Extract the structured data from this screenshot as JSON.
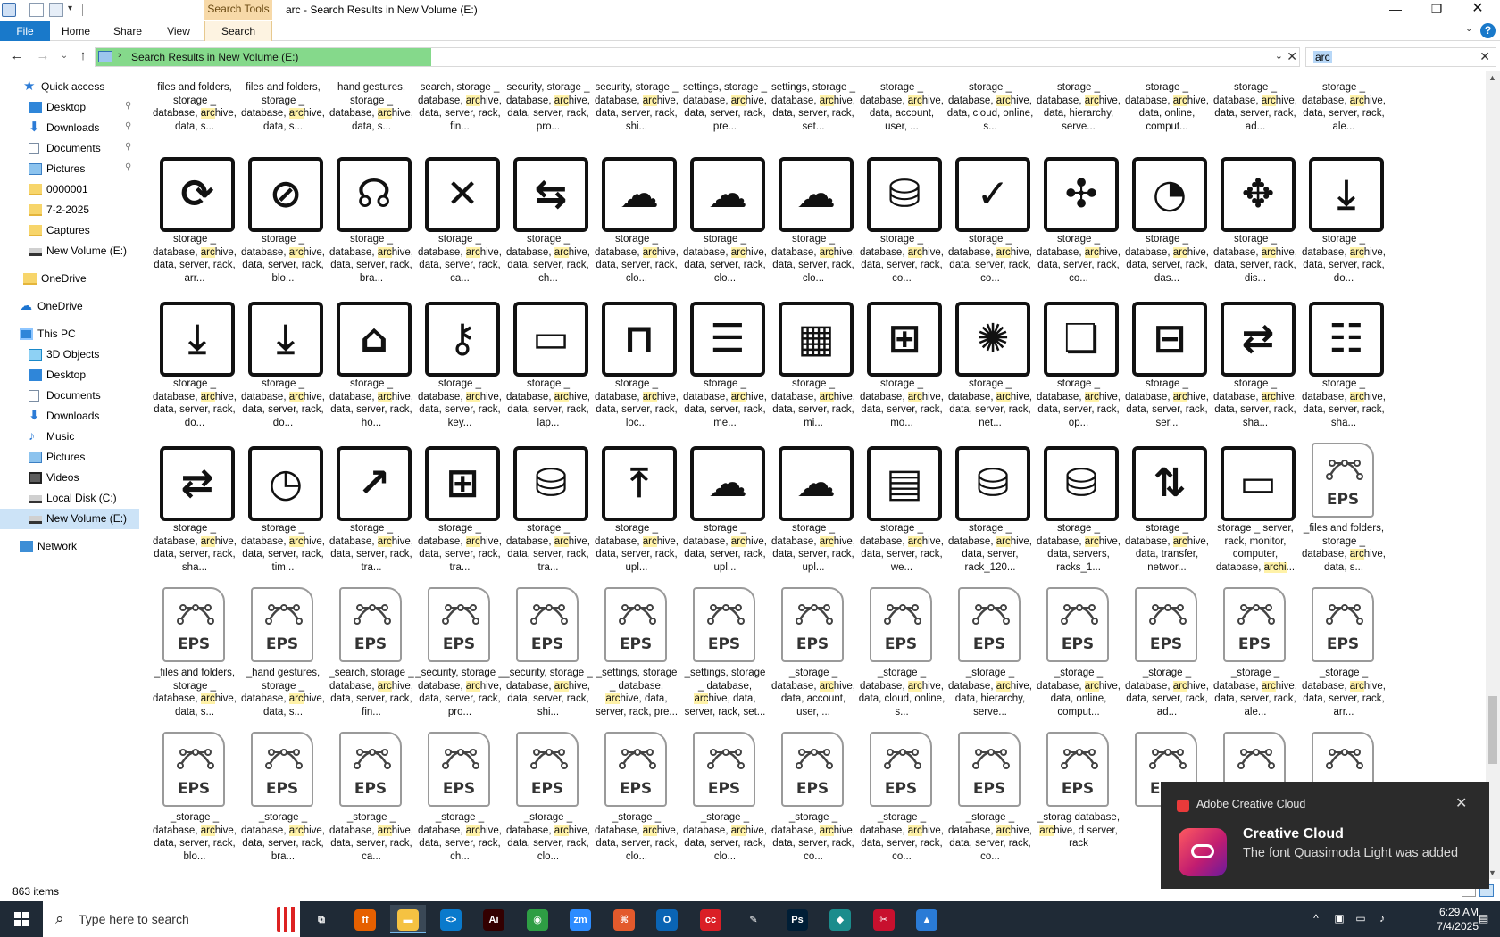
{
  "window": {
    "title": "arc - Search Results in New Volume (E:)",
    "context_tab_header": "Search Tools",
    "min_glyph": "—",
    "max_glyph": "❐",
    "close_glyph": "✕"
  },
  "ribbon": {
    "tabs": [
      "File",
      "Home",
      "Share",
      "View",
      "Search"
    ],
    "active_tab": "File"
  },
  "address": {
    "path": "Search Results in New Volume (E:)",
    "search_value": "arc"
  },
  "nav": {
    "items": [
      {
        "label": "Quick access",
        "icon": "star-icon",
        "pinned": false
      },
      {
        "label": "Desktop",
        "icon": "desktop-icon",
        "pinned": true
      },
      {
        "label": "Downloads",
        "icon": "downloads-icon",
        "pinned": true
      },
      {
        "label": "Documents",
        "icon": "documents-icon",
        "pinned": true
      },
      {
        "label": "Pictures",
        "icon": "pictures-icon",
        "pinned": true
      },
      {
        "label": "0000001",
        "icon": "folder-icon",
        "pinned": false
      },
      {
        "label": "7-2-2025",
        "icon": "folder-icon",
        "pinned": false
      },
      {
        "label": "Captures",
        "icon": "folder-icon",
        "pinned": false
      },
      {
        "label": "New Volume (E:)",
        "icon": "drive-icon",
        "pinned": false
      },
      {
        "label": "OneDrive",
        "icon": "folder-icon",
        "pinned": false
      },
      {
        "label": "OneDrive",
        "icon": "cloud-icon",
        "pinned": false
      },
      {
        "label": "This PC",
        "icon": "pc-icon",
        "pinned": false
      },
      {
        "label": "3D Objects",
        "icon": "3d-objects-icon",
        "pinned": false
      },
      {
        "label": "Desktop",
        "icon": "desktop-icon",
        "pinned": false
      },
      {
        "label": "Documents",
        "icon": "documents-icon",
        "pinned": false
      },
      {
        "label": "Downloads",
        "icon": "downloads-icon",
        "pinned": false
      },
      {
        "label": "Music",
        "icon": "music-icon",
        "pinned": false
      },
      {
        "label": "Pictures",
        "icon": "pictures-icon",
        "pinned": false
      },
      {
        "label": "Videos",
        "icon": "videos-icon",
        "pinned": false
      },
      {
        "label": "Local Disk (C:)",
        "icon": "drive-icon",
        "pinned": false
      },
      {
        "label": "New Volume (E:)",
        "icon": "drive-icon",
        "pinned": false
      },
      {
        "label": "Network",
        "icon": "network-icon",
        "pinned": false
      }
    ],
    "selected": "New Volume (E:)"
  },
  "files": {
    "rows": [
      {
        "kind": "partial",
        "items": [
          {
            "pre": "files and folders, storage _ database, ",
            "hl": "arc",
            "post": "hive, data, s..."
          },
          {
            "pre": "files and folders, storage _ database, ",
            "hl": "arc",
            "post": "hive, data, s..."
          },
          {
            "pre": "hand gestures, storage _ database, ",
            "hl": "arc",
            "post": "hive, data, s..."
          },
          {
            "pre": "search, storage _ database, ",
            "hl": "arc",
            "post": "hive, data, server, rack, fin..."
          },
          {
            "pre": "security, storage _ database, ",
            "hl": "arc",
            "post": "hive, data, server, rack, pro..."
          },
          {
            "pre": "security, storage _ database, ",
            "hl": "arc",
            "post": "hive, data, server, rack, shi..."
          },
          {
            "pre": "settings, storage _ database, ",
            "hl": "arc",
            "post": "hive, data, server, rack, pre..."
          },
          {
            "pre": "settings, storage _ database, ",
            "hl": "arc",
            "post": "hive, data, server, rack, set..."
          },
          {
            "pre": "storage _ database, ",
            "hl": "arc",
            "post": "hive, data, account, user, ..."
          },
          {
            "pre": "storage _ database, ",
            "hl": "arc",
            "post": "hive, data, cloud, online, s..."
          },
          {
            "pre": "storage _ database, ",
            "hl": "arc",
            "post": "hive, data, hierarchy, serve..."
          },
          {
            "pre": "storage _ database, ",
            "hl": "arc",
            "post": "hive, data, online, comput..."
          },
          {
            "pre": "storage _ database, ",
            "hl": "arc",
            "post": "hive, data, server, rack, ad..."
          },
          {
            "pre": "storage _ database, ",
            "hl": "arc",
            "post": "hive, data, server, rack, ale..."
          }
        ]
      },
      {
        "kind": "icon",
        "items": [
          {
            "glyph": "⟳",
            "pre": "storage _ database, ",
            "hl": "arc",
            "post": "hive, data, server, rack, arr..."
          },
          {
            "glyph": "⊘",
            "pre": "storage _ database, ",
            "hl": "arc",
            "post": "hive, data, server, rack, blo..."
          },
          {
            "glyph": "☊",
            "pre": "storage _ database, ",
            "hl": "arc",
            "post": "hive, data, server, rack, bra..."
          },
          {
            "glyph": "✕",
            "pre": "storage _ database, ",
            "hl": "arc",
            "post": "hive, data, server, rack, ca..."
          },
          {
            "glyph": "⇆",
            "pre": "storage _ database, ",
            "hl": "arc",
            "post": "hive, data, server, rack, ch..."
          },
          {
            "glyph": "☁",
            "pre": "storage _ database, ",
            "hl": "arc",
            "post": "hive, data, server, rack, clo..."
          },
          {
            "glyph": "☁",
            "pre": "storage _ database, ",
            "hl": "arc",
            "post": "hive, data, server, rack, clo..."
          },
          {
            "glyph": "☁",
            "pre": "storage _ database, ",
            "hl": "arc",
            "post": "hive, data, server, rack, clo..."
          },
          {
            "glyph": "⛁",
            "pre": "storage _ database, ",
            "hl": "arc",
            "post": "hive, data, server, rack, co..."
          },
          {
            "glyph": "✓",
            "pre": "storage _ database, ",
            "hl": "arc",
            "post": "hive, data, server, rack, co..."
          },
          {
            "glyph": "✣",
            "pre": "storage _ database, ",
            "hl": "arc",
            "post": "hive, data, server, rack, co..."
          },
          {
            "glyph": "◔",
            "pre": "storage _ database, ",
            "hl": "arc",
            "post": "hive, data, server, rack, das..."
          },
          {
            "glyph": "✥",
            "pre": "storage _ database, ",
            "hl": "arc",
            "post": "hive, data, server, rack, dis..."
          },
          {
            "glyph": "⤓",
            "pre": "storage _ database, ",
            "hl": "arc",
            "post": "hive, data, server, rack, do..."
          }
        ]
      },
      {
        "kind": "icon",
        "items": [
          {
            "glyph": "⤓",
            "pre": "storage _ database, ",
            "hl": "arc",
            "post": "hive, data, server, rack, do..."
          },
          {
            "glyph": "⤓",
            "pre": "storage _ database, ",
            "hl": "arc",
            "post": "hive, data, server, rack, do..."
          },
          {
            "glyph": "⌂",
            "pre": "storage _ database, ",
            "hl": "arc",
            "post": "hive, data, server, rack, ho..."
          },
          {
            "glyph": "⚷",
            "pre": "storage _ database, ",
            "hl": "arc",
            "post": "hive, data, server, rack, key..."
          },
          {
            "glyph": "▭",
            "pre": "storage _ database, ",
            "hl": "arc",
            "post": "hive, data, server, rack, lap..."
          },
          {
            "glyph": "⊓",
            "pre": "storage _ database, ",
            "hl": "arc",
            "post": "hive, data, server, rack, loc..."
          },
          {
            "glyph": "☰",
            "pre": "storage _ database, ",
            "hl": "arc",
            "post": "hive, data, server, rack, me..."
          },
          {
            "glyph": "▦",
            "pre": "storage _ database, ",
            "hl": "arc",
            "post": "hive, data, server, rack, mi..."
          },
          {
            "glyph": "⊞",
            "pre": "storage _ database, ",
            "hl": "arc",
            "post": "hive, data, server, rack, mo..."
          },
          {
            "glyph": "✺",
            "pre": "storage _ database, ",
            "hl": "arc",
            "post": "hive, data, server, rack, net..."
          },
          {
            "glyph": "❏",
            "pre": "storage _ database, ",
            "hl": "arc",
            "post": "hive, data, server, rack, op..."
          },
          {
            "glyph": "⊟",
            "pre": "storage _ database, ",
            "hl": "arc",
            "post": "hive, data, server, rack, ser..."
          },
          {
            "glyph": "⇄",
            "pre": "storage _ database, ",
            "hl": "arc",
            "post": "hive, data, server, rack, sha..."
          },
          {
            "glyph": "☷",
            "pre": "storage _ database, ",
            "hl": "arc",
            "post": "hive, data, server, rack, sha..."
          }
        ]
      },
      {
        "kind": "icon",
        "items": [
          {
            "glyph": "⇄",
            "pre": "storage _ database, ",
            "hl": "arc",
            "post": "hive, data, server, rack, sha..."
          },
          {
            "glyph": "◷",
            "pre": "storage _ database, ",
            "hl": "arc",
            "post": "hive, data, server, rack, tim..."
          },
          {
            "glyph": "↗",
            "pre": "storage _ database, ",
            "hl": "arc",
            "post": "hive, data, server, rack, tra..."
          },
          {
            "glyph": "⊞",
            "pre": "storage _ database, ",
            "hl": "arc",
            "post": "hive, data, server, rack, tra..."
          },
          {
            "glyph": "⛁",
            "pre": "storage _ database, ",
            "hl": "arc",
            "post": "hive, data, server, rack, tra..."
          },
          {
            "glyph": "⤒",
            "pre": "storage _ database, ",
            "hl": "arc",
            "post": "hive, data, server, rack, upl..."
          },
          {
            "glyph": "☁",
            "pre": "storage _ database, ",
            "hl": "arc",
            "post": "hive, data, server, rack, upl..."
          },
          {
            "glyph": "☁",
            "pre": "storage _ database, ",
            "hl": "arc",
            "post": "hive, data, server, rack, upl..."
          },
          {
            "glyph": "▤",
            "pre": "storage _ database, ",
            "hl": "arc",
            "post": "hive, data, server, rack, we..."
          },
          {
            "glyph": "⛁",
            "pre": "storage _ database, ",
            "hl": "arc",
            "post": "hive, data, server, rack_120..."
          },
          {
            "glyph": "⛁",
            "pre": "storage _ database, ",
            "hl": "arc",
            "post": "hive, data, servers, racks_1..."
          },
          {
            "glyph": "⇅",
            "pre": "storage _ database, ",
            "hl": "arc",
            "post": "hive, data, transfer, networ..."
          },
          {
            "glyph": "▭",
            "pre": "storage _ server, rack, monitor, computer, database, ",
            "hl": "archi",
            "post": "..."
          },
          {
            "eps": true,
            "pre": "_files and folders, storage _ database, ",
            "hl": "arc",
            "post": "hive, data, s..."
          }
        ]
      },
      {
        "kind": "eps",
        "items": [
          {
            "pre": "_files and folders, storage _ database, ",
            "hl": "arc",
            "post": "hive, data, s..."
          },
          {
            "pre": "_hand gestures, storage _ database, ",
            "hl": "arc",
            "post": "hive, data, s..."
          },
          {
            "pre": "_search, storage _ database, ",
            "hl": "arc",
            "post": "hive, data, server, rack, fin..."
          },
          {
            "pre": "_security, storage _ database, ",
            "hl": "arc",
            "post": "hive, data, server, rack, pro..."
          },
          {
            "pre": "_security, storage _ database, ",
            "hl": "arc",
            "post": "hive, data, server, rack, shi..."
          },
          {
            "pre": "_settings, storage _ database, ",
            "hl": "arc",
            "post": "hive, data, server, rack, pre..."
          },
          {
            "pre": "_settings, storage _ database, ",
            "hl": "arc",
            "post": "hive, data, server, rack, set..."
          },
          {
            "pre": "_storage _ database, ",
            "hl": "arc",
            "post": "hive, data, account, user, ..."
          },
          {
            "pre": "_storage _ database, ",
            "hl": "arc",
            "post": "hive, data, cloud, online, s..."
          },
          {
            "pre": "_storage _ database, ",
            "hl": "arc",
            "post": "hive, data, hierarchy, serve..."
          },
          {
            "pre": "_storage _ database, ",
            "hl": "arc",
            "post": "hive, data, online, comput..."
          },
          {
            "pre": "_storage _ database, ",
            "hl": "arc",
            "post": "hive, data, server, rack, ad..."
          },
          {
            "pre": "_storage _ database, ",
            "hl": "arc",
            "post": "hive, data, server, rack, ale..."
          },
          {
            "pre": "_storage _ database, ",
            "hl": "arc",
            "post": "hive, data, server, rack, arr..."
          }
        ]
      },
      {
        "kind": "eps",
        "items": [
          {
            "pre": "_storage _ database, ",
            "hl": "arc",
            "post": "hive, data, server, rack, blo..."
          },
          {
            "pre": "_storage _ database, ",
            "hl": "arc",
            "post": "hive, data, server, rack, bra..."
          },
          {
            "pre": "_storage _ database, ",
            "hl": "arc",
            "post": "hive, data, server, rack, ca..."
          },
          {
            "pre": "_storage _ database, ",
            "hl": "arc",
            "post": "hive, data, server, rack, ch..."
          },
          {
            "pre": "_storage _ database, ",
            "hl": "arc",
            "post": "hive, data, server, rack, clo..."
          },
          {
            "pre": "_storage _ database, ",
            "hl": "arc",
            "post": "hive, data, server, rack, clo..."
          },
          {
            "pre": "_storage _ database, ",
            "hl": "arc",
            "post": "hive, data, server, rack, clo..."
          },
          {
            "pre": "_storage _ database, ",
            "hl": "arc",
            "post": "hive, data, server, rack, co..."
          },
          {
            "pre": "_storage _ database, ",
            "hl": "arc",
            "post": "hive, data, server, rack, co..."
          },
          {
            "pre": "_storage _ database, ",
            "hl": "arc",
            "post": "hive, data, server, rack, co..."
          },
          {
            "pre": "_storag database, ",
            "hl": "arc",
            "post": "hive, d server, rack"
          },
          {
            "pre": "",
            "hl": "",
            "post": ""
          },
          {
            "pre": "",
            "hl": "",
            "post": ""
          },
          {
            "pre": "",
            "hl": "",
            "post": ""
          }
        ]
      }
    ],
    "eps_label": "EPS"
  },
  "status": {
    "count": "863 items"
  },
  "toast": {
    "app": "Adobe Creative Cloud",
    "title": "Creative Cloud",
    "body": "The font Quasimoda Light was added"
  },
  "taskbar": {
    "search_placeholder": "Type here to search",
    "apps": [
      {
        "name": "task-view",
        "label": "⧉",
        "color": "#1f2a36"
      },
      {
        "name": "firefox",
        "label": "ff",
        "color": "#e66000"
      },
      {
        "name": "file-explorer",
        "label": "▬",
        "color": "#f5c242",
        "active": true
      },
      {
        "name": "vscode",
        "label": "<>",
        "color": "#0a7acc"
      },
      {
        "name": "illustrator",
        "label": "Ai",
        "color": "#330000"
      },
      {
        "name": "chrome",
        "label": "◉",
        "color": "#2e9e44"
      },
      {
        "name": "zoom",
        "label": "zm",
        "color": "#2d8cff"
      },
      {
        "name": "app-orange",
        "label": "⌘",
        "color": "#e35a2c"
      },
      {
        "name": "outlook",
        "label": "O",
        "color": "#0a64b4"
      },
      {
        "name": "creative-cloud",
        "label": "cc",
        "color": "#da1f26"
      },
      {
        "name": "pen-tool",
        "label": "✎",
        "color": "#1f2a36"
      },
      {
        "name": "photoshop",
        "label": "Ps",
        "color": "#001e36"
      },
      {
        "name": "app-teal",
        "label": "◆",
        "color": "#1b8c8c"
      },
      {
        "name": "app-red",
        "label": "✂",
        "color": "#c8102e"
      },
      {
        "name": "app-blue",
        "label": "▲",
        "color": "#2a7bd6"
      }
    ],
    "time": "6:29 AM",
    "date": "7/4/2025"
  },
  "colors": {
    "accent": "#1979ca",
    "highlight": "#fff2a8",
    "search_progress": "#85d98b",
    "taskbar": "#1f2a36"
  }
}
